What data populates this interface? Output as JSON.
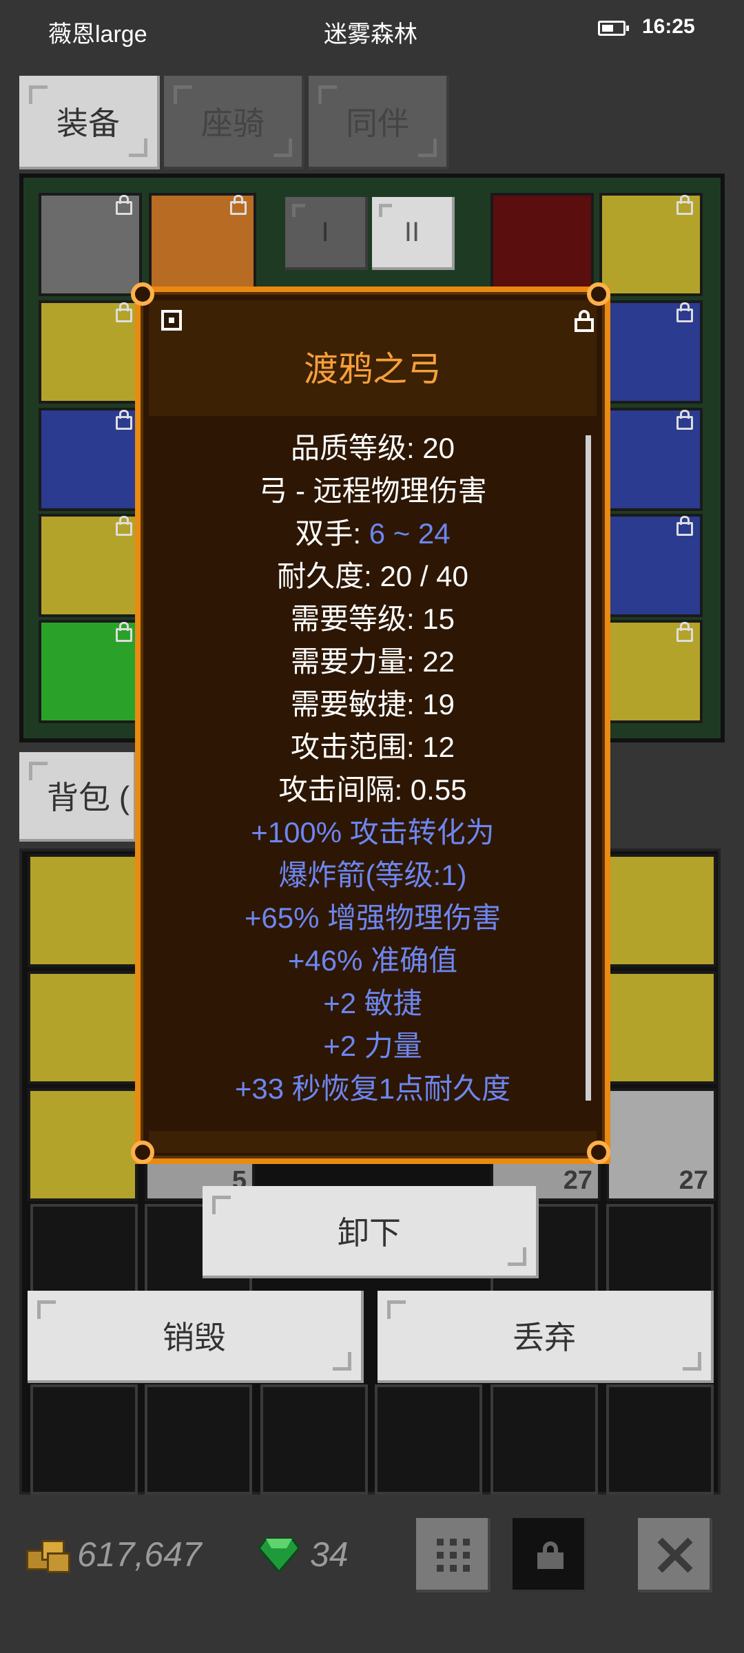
{
  "status_bar": {
    "player_name": "薇恩large",
    "location": "迷雾森林",
    "time": "16:25"
  },
  "tabs": [
    {
      "label": "装备",
      "active": true
    },
    {
      "label": "座骑",
      "active": false
    },
    {
      "label": "同伴",
      "active": false
    }
  ],
  "weapon_sets": [
    "I",
    "II"
  ],
  "bag_tab": {
    "label": "背包 ("
  },
  "inventory": {
    "stack_counts": [
      "5",
      "27",
      "27"
    ]
  },
  "tooltip": {
    "item_name": "渡鸦之弓",
    "stats": [
      {
        "label": "品质等级: 20"
      },
      {
        "label": "弓 - 远程物理伤害"
      },
      {
        "label": "双手: ",
        "value": "6 ~ 24"
      },
      {
        "label": "耐久度: 20 / 40"
      },
      {
        "label": "需要等级: 15"
      },
      {
        "label": "需要力量: 22"
      },
      {
        "label": "需要敏捷: 19"
      },
      {
        "label": "攻击范围: 12"
      },
      {
        "label": "攻击间隔: 0.55"
      }
    ],
    "affixes": [
      "+100% 攻击转化为",
      "爆炸箭(等级:1)",
      "+65% 增强物理伤害",
      "+46% 准确值",
      "+2 敏捷",
      "+2 力量",
      "+33 秒恢复1点耐久度"
    ]
  },
  "actions": {
    "unequip": "卸下",
    "destroy": "销毁",
    "discard": "丢弃"
  },
  "currency": {
    "gold": "617,647",
    "gems": "34"
  },
  "colors": {
    "tooltip_border": "#e98a12",
    "item_name": "#f6a03b",
    "affix_blue": "#6d86f0"
  }
}
